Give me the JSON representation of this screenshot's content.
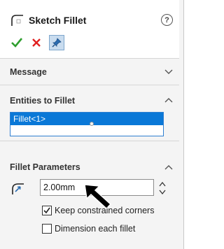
{
  "header": {
    "title": "Sketch Fillet",
    "help_symbol": "?"
  },
  "actions": {
    "ok_color": "#2e9e2e",
    "cancel_color": "#e02020"
  },
  "sections": {
    "message": {
      "label": "Message",
      "expanded": false
    },
    "entities": {
      "label": "Entities to Fillet",
      "expanded": true,
      "items": [
        "Fillet<1>"
      ],
      "selected_index": 0
    },
    "parameters": {
      "label": "Fillet Parameters",
      "expanded": true,
      "radius_value": "2.00mm",
      "options": [
        {
          "label": "Keep constrained corners",
          "checked": true
        },
        {
          "label": "Dimension each fillet",
          "checked": false
        }
      ]
    }
  },
  "colors": {
    "selection": "#0a78d7",
    "panel_bg": "#f4f4f4"
  }
}
